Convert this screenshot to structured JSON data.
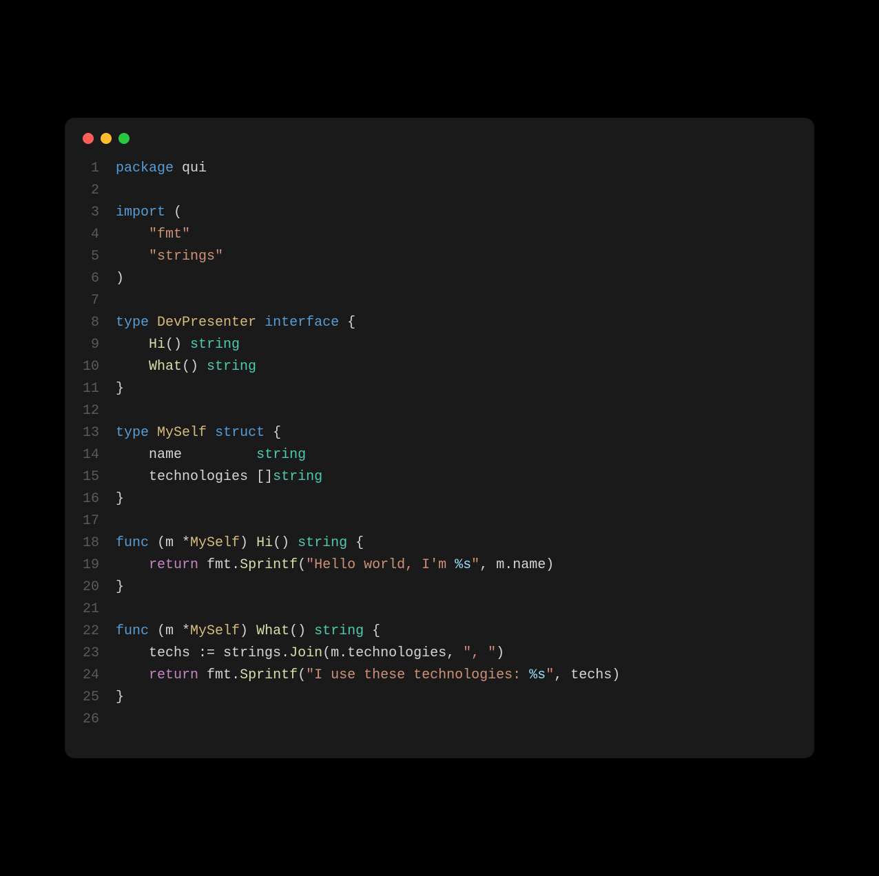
{
  "window": {
    "traffic_lights": [
      "close",
      "minimize",
      "maximize"
    ]
  },
  "editor": {
    "language": "go",
    "lines": [
      {
        "n": 1,
        "tokens": [
          {
            "c": "kw",
            "t": "package"
          },
          {
            "c": "punct",
            "t": " "
          },
          {
            "c": "ident",
            "t": "qui"
          }
        ]
      },
      {
        "n": 2,
        "tokens": []
      },
      {
        "n": 3,
        "tokens": [
          {
            "c": "kw",
            "t": "import"
          },
          {
            "c": "punct",
            "t": " ("
          }
        ]
      },
      {
        "n": 4,
        "tokens": [
          {
            "c": "punct",
            "t": "    "
          },
          {
            "c": "str",
            "t": "\"fmt\""
          }
        ]
      },
      {
        "n": 5,
        "tokens": [
          {
            "c": "punct",
            "t": "    "
          },
          {
            "c": "str",
            "t": "\"strings\""
          }
        ]
      },
      {
        "n": 6,
        "tokens": [
          {
            "c": "punct",
            "t": ")"
          }
        ]
      },
      {
        "n": 7,
        "tokens": []
      },
      {
        "n": 8,
        "tokens": [
          {
            "c": "kw",
            "t": "type"
          },
          {
            "c": "punct",
            "t": " "
          },
          {
            "c": "typname",
            "t": "DevPresenter"
          },
          {
            "c": "punct",
            "t": " "
          },
          {
            "c": "kw",
            "t": "interface"
          },
          {
            "c": "punct",
            "t": " {"
          }
        ]
      },
      {
        "n": 9,
        "tokens": [
          {
            "c": "punct",
            "t": "    "
          },
          {
            "c": "fn",
            "t": "Hi"
          },
          {
            "c": "punct",
            "t": "() "
          },
          {
            "c": "typ",
            "t": "string"
          }
        ]
      },
      {
        "n": 10,
        "tokens": [
          {
            "c": "punct",
            "t": "    "
          },
          {
            "c": "fn",
            "t": "What"
          },
          {
            "c": "punct",
            "t": "() "
          },
          {
            "c": "typ",
            "t": "string"
          }
        ]
      },
      {
        "n": 11,
        "tokens": [
          {
            "c": "punct",
            "t": "}"
          }
        ]
      },
      {
        "n": 12,
        "tokens": []
      },
      {
        "n": 13,
        "tokens": [
          {
            "c": "kw",
            "t": "type"
          },
          {
            "c": "punct",
            "t": " "
          },
          {
            "c": "typname",
            "t": "MySelf"
          },
          {
            "c": "punct",
            "t": " "
          },
          {
            "c": "kw",
            "t": "struct"
          },
          {
            "c": "punct",
            "t": " {"
          }
        ]
      },
      {
        "n": 14,
        "tokens": [
          {
            "c": "punct",
            "t": "    "
          },
          {
            "c": "ident",
            "t": "name"
          },
          {
            "c": "punct",
            "t": "         "
          },
          {
            "c": "typ",
            "t": "string"
          }
        ]
      },
      {
        "n": 15,
        "tokens": [
          {
            "c": "punct",
            "t": "    "
          },
          {
            "c": "ident",
            "t": "technologies"
          },
          {
            "c": "punct",
            "t": " []"
          },
          {
            "c": "typ",
            "t": "string"
          }
        ]
      },
      {
        "n": 16,
        "tokens": [
          {
            "c": "punct",
            "t": "}"
          }
        ]
      },
      {
        "n": 17,
        "tokens": []
      },
      {
        "n": 18,
        "tokens": [
          {
            "c": "kw",
            "t": "func"
          },
          {
            "c": "punct",
            "t": " (m *"
          },
          {
            "c": "typname",
            "t": "MySelf"
          },
          {
            "c": "punct",
            "t": ") "
          },
          {
            "c": "fn",
            "t": "Hi"
          },
          {
            "c": "punct",
            "t": "() "
          },
          {
            "c": "typ",
            "t": "string"
          },
          {
            "c": "punct",
            "t": " {"
          }
        ]
      },
      {
        "n": 19,
        "tokens": [
          {
            "c": "punct",
            "t": "    "
          },
          {
            "c": "ctrl",
            "t": "return"
          },
          {
            "c": "punct",
            "t": " "
          },
          {
            "c": "ident",
            "t": "fmt"
          },
          {
            "c": "punct",
            "t": "."
          },
          {
            "c": "fn",
            "t": "Sprintf"
          },
          {
            "c": "punct",
            "t": "("
          },
          {
            "c": "str",
            "t": "\"Hello world, I'm "
          },
          {
            "c": "ph",
            "t": "%s"
          },
          {
            "c": "str",
            "t": "\""
          },
          {
            "c": "punct",
            "t": ", m.name)"
          }
        ]
      },
      {
        "n": 20,
        "tokens": [
          {
            "c": "punct",
            "t": "}"
          }
        ]
      },
      {
        "n": 21,
        "tokens": []
      },
      {
        "n": 22,
        "tokens": [
          {
            "c": "kw",
            "t": "func"
          },
          {
            "c": "punct",
            "t": " (m *"
          },
          {
            "c": "typname",
            "t": "MySelf"
          },
          {
            "c": "punct",
            "t": ") "
          },
          {
            "c": "fn",
            "t": "What"
          },
          {
            "c": "punct",
            "t": "() "
          },
          {
            "c": "typ",
            "t": "string"
          },
          {
            "c": "punct",
            "t": " {"
          }
        ]
      },
      {
        "n": 23,
        "tokens": [
          {
            "c": "punct",
            "t": "    techs "
          },
          {
            "c": "op",
            "t": ":="
          },
          {
            "c": "punct",
            "t": " strings."
          },
          {
            "c": "fn",
            "t": "Join"
          },
          {
            "c": "punct",
            "t": "(m.technologies, "
          },
          {
            "c": "str",
            "t": "\", \""
          },
          {
            "c": "punct",
            "t": ")"
          }
        ]
      },
      {
        "n": 24,
        "tokens": [
          {
            "c": "punct",
            "t": "    "
          },
          {
            "c": "ctrl",
            "t": "return"
          },
          {
            "c": "punct",
            "t": " "
          },
          {
            "c": "ident",
            "t": "fmt"
          },
          {
            "c": "punct",
            "t": "."
          },
          {
            "c": "fn",
            "t": "Sprintf"
          },
          {
            "c": "punct",
            "t": "("
          },
          {
            "c": "str",
            "t": "\"I use these technologies: "
          },
          {
            "c": "ph",
            "t": "%s"
          },
          {
            "c": "str",
            "t": "\""
          },
          {
            "c": "punct",
            "t": ", techs)"
          }
        ]
      },
      {
        "n": 25,
        "tokens": [
          {
            "c": "punct",
            "t": "}"
          }
        ]
      },
      {
        "n": 26,
        "tokens": []
      }
    ]
  }
}
